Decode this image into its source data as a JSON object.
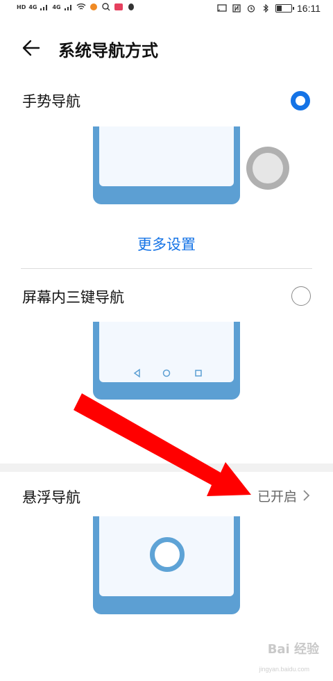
{
  "status_bar": {
    "left_labels": [
      "HD",
      "4G",
      "4G"
    ],
    "time": "16:11",
    "battery_level": 0.3,
    "icons": [
      "cast-icon",
      "nfc-icon",
      "alarm-icon",
      "bluetooth-icon",
      "battery-icon"
    ]
  },
  "header": {
    "title": "系统导航方式"
  },
  "options": {
    "gesture": {
      "label": "手势导航",
      "selected": true
    },
    "more_settings": "更多设置",
    "three_key": {
      "label": "屏幕内三键导航",
      "selected": false
    },
    "floating": {
      "label": "悬浮导航",
      "status": "已开启"
    }
  },
  "watermark": {
    "text": "Bai 经验",
    "sub": "jingyan.baidu.com"
  },
  "colors": {
    "accent": "#1473e6",
    "phone_frame": "#5c9fd3",
    "annotation_arrow": "#ff0000"
  }
}
